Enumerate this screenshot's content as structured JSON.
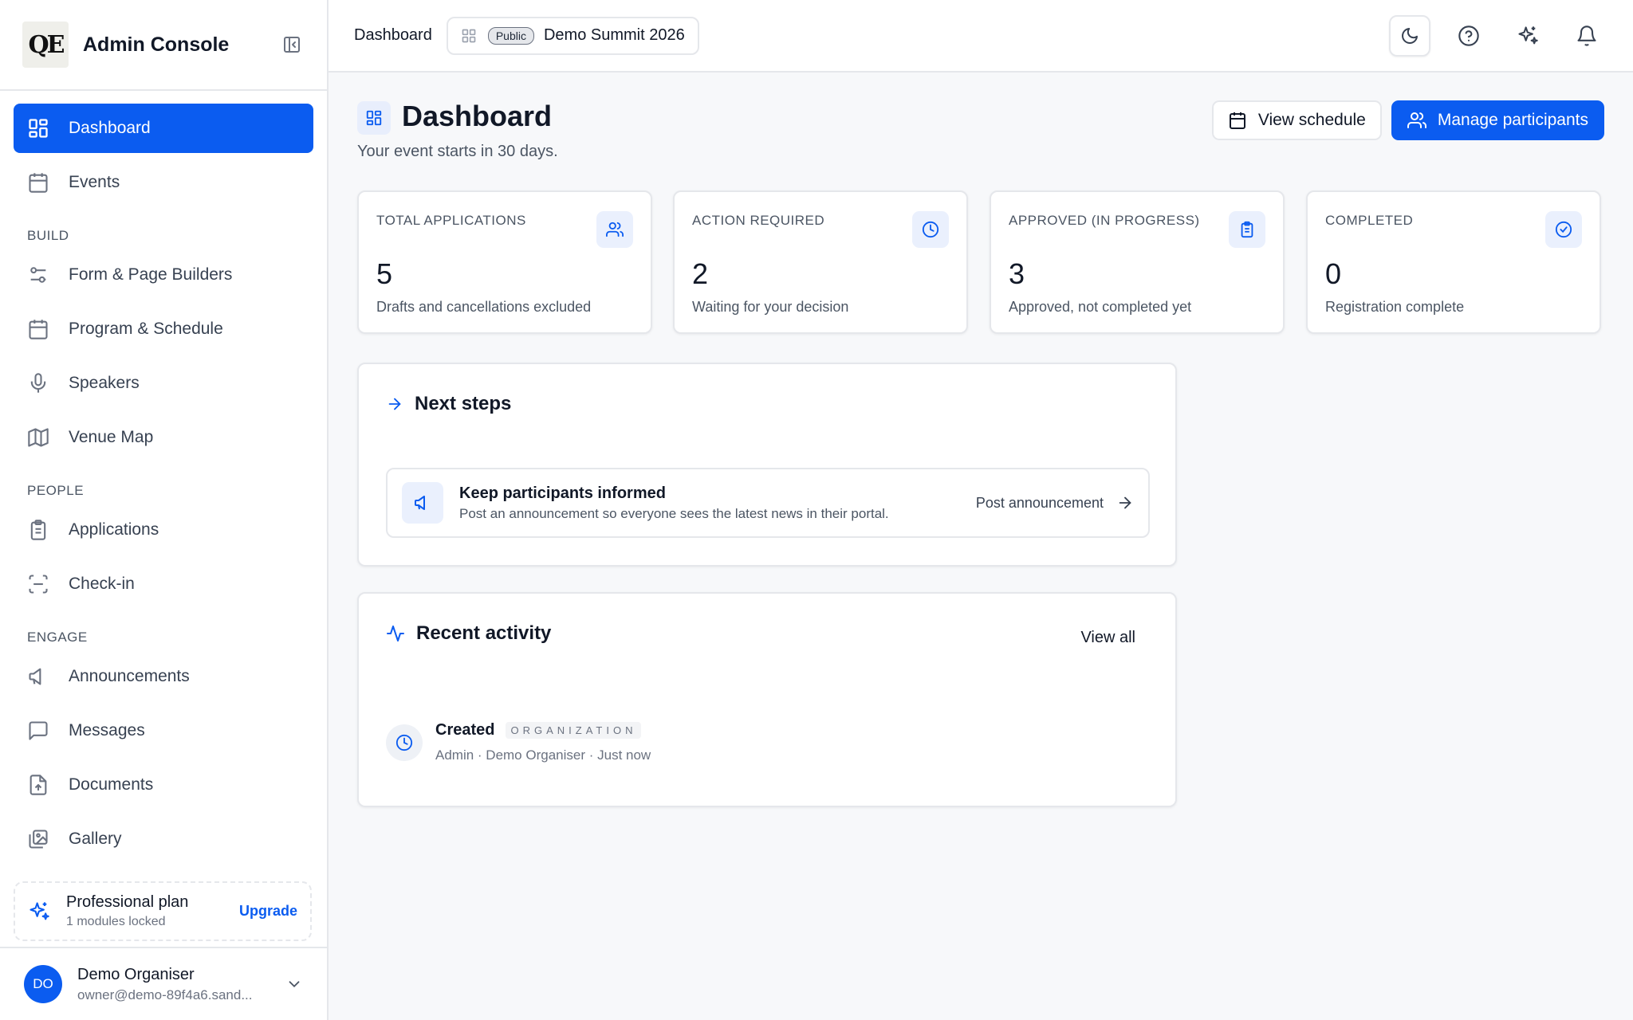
{
  "sidebar": {
    "logo_text": "QE",
    "app_title": "Admin Console",
    "nav_top": [
      {
        "label": "Dashboard",
        "icon": "grid-icon",
        "active": true
      },
      {
        "label": "Events",
        "icon": "calendar-icon"
      }
    ],
    "sections": [
      {
        "label": "BUILD",
        "items": [
          {
            "label": "Form & Page Builders",
            "icon": "sliders-icon"
          },
          {
            "label": "Program & Schedule",
            "icon": "calendar-icon"
          },
          {
            "label": "Speakers",
            "icon": "microphone-icon"
          },
          {
            "label": "Venue Map",
            "icon": "map-icon"
          }
        ]
      },
      {
        "label": "PEOPLE",
        "items": [
          {
            "label": "Applications",
            "icon": "clipboard-icon"
          },
          {
            "label": "Check-in",
            "icon": "scan-icon"
          }
        ]
      },
      {
        "label": "ENGAGE",
        "items": [
          {
            "label": "Announcements",
            "icon": "megaphone-icon"
          },
          {
            "label": "Messages",
            "icon": "message-icon"
          },
          {
            "label": "Documents",
            "icon": "document-icon"
          },
          {
            "label": "Gallery",
            "icon": "gallery-icon"
          }
        ]
      }
    ],
    "plan": {
      "title": "Professional plan",
      "subtitle": "1 modules locked",
      "upgrade_label": "Upgrade"
    },
    "user": {
      "initials": "DO",
      "name": "Demo Organiser",
      "email": "owner@demo-89f4a6.sand..."
    }
  },
  "topbar": {
    "breadcrumb": "Dashboard",
    "event_badge": "Public",
    "event_name": "Demo Summit 2026"
  },
  "page": {
    "title": "Dashboard",
    "subtitle": "Your event starts in 30 days.",
    "view_schedule_label": "View schedule",
    "manage_participants_label": "Manage participants"
  },
  "stats": [
    {
      "label": "TOTAL APPLICATIONS",
      "value": "5",
      "subtitle": "Drafts and cancellations excluded",
      "icon": "users-icon"
    },
    {
      "label": "ACTION REQUIRED",
      "value": "2",
      "subtitle": "Waiting for your decision",
      "icon": "clock-icon"
    },
    {
      "label": "APPROVED (IN PROGRESS)",
      "value": "3",
      "subtitle": "Approved, not completed yet",
      "icon": "clipboard-icon"
    },
    {
      "label": "COMPLETED",
      "value": "0",
      "subtitle": "Registration complete",
      "icon": "check-circle-icon"
    }
  ],
  "next_steps": {
    "title": "Next steps",
    "item": {
      "title": "Keep participants informed",
      "subtitle": "Post an announcement so everyone sees the latest news in their portal.",
      "action_label": "Post announcement"
    }
  },
  "recent_activity": {
    "title": "Recent activity",
    "view_all_label": "View all",
    "items": [
      {
        "title": "Created",
        "tag": "ORGANIZATION",
        "meta": "Admin · Demo Organiser · Just now"
      }
    ]
  },
  "colors": {
    "accent": "#0b5cf0",
    "border": "#e5e7eb",
    "background": "#f7f8fa"
  }
}
